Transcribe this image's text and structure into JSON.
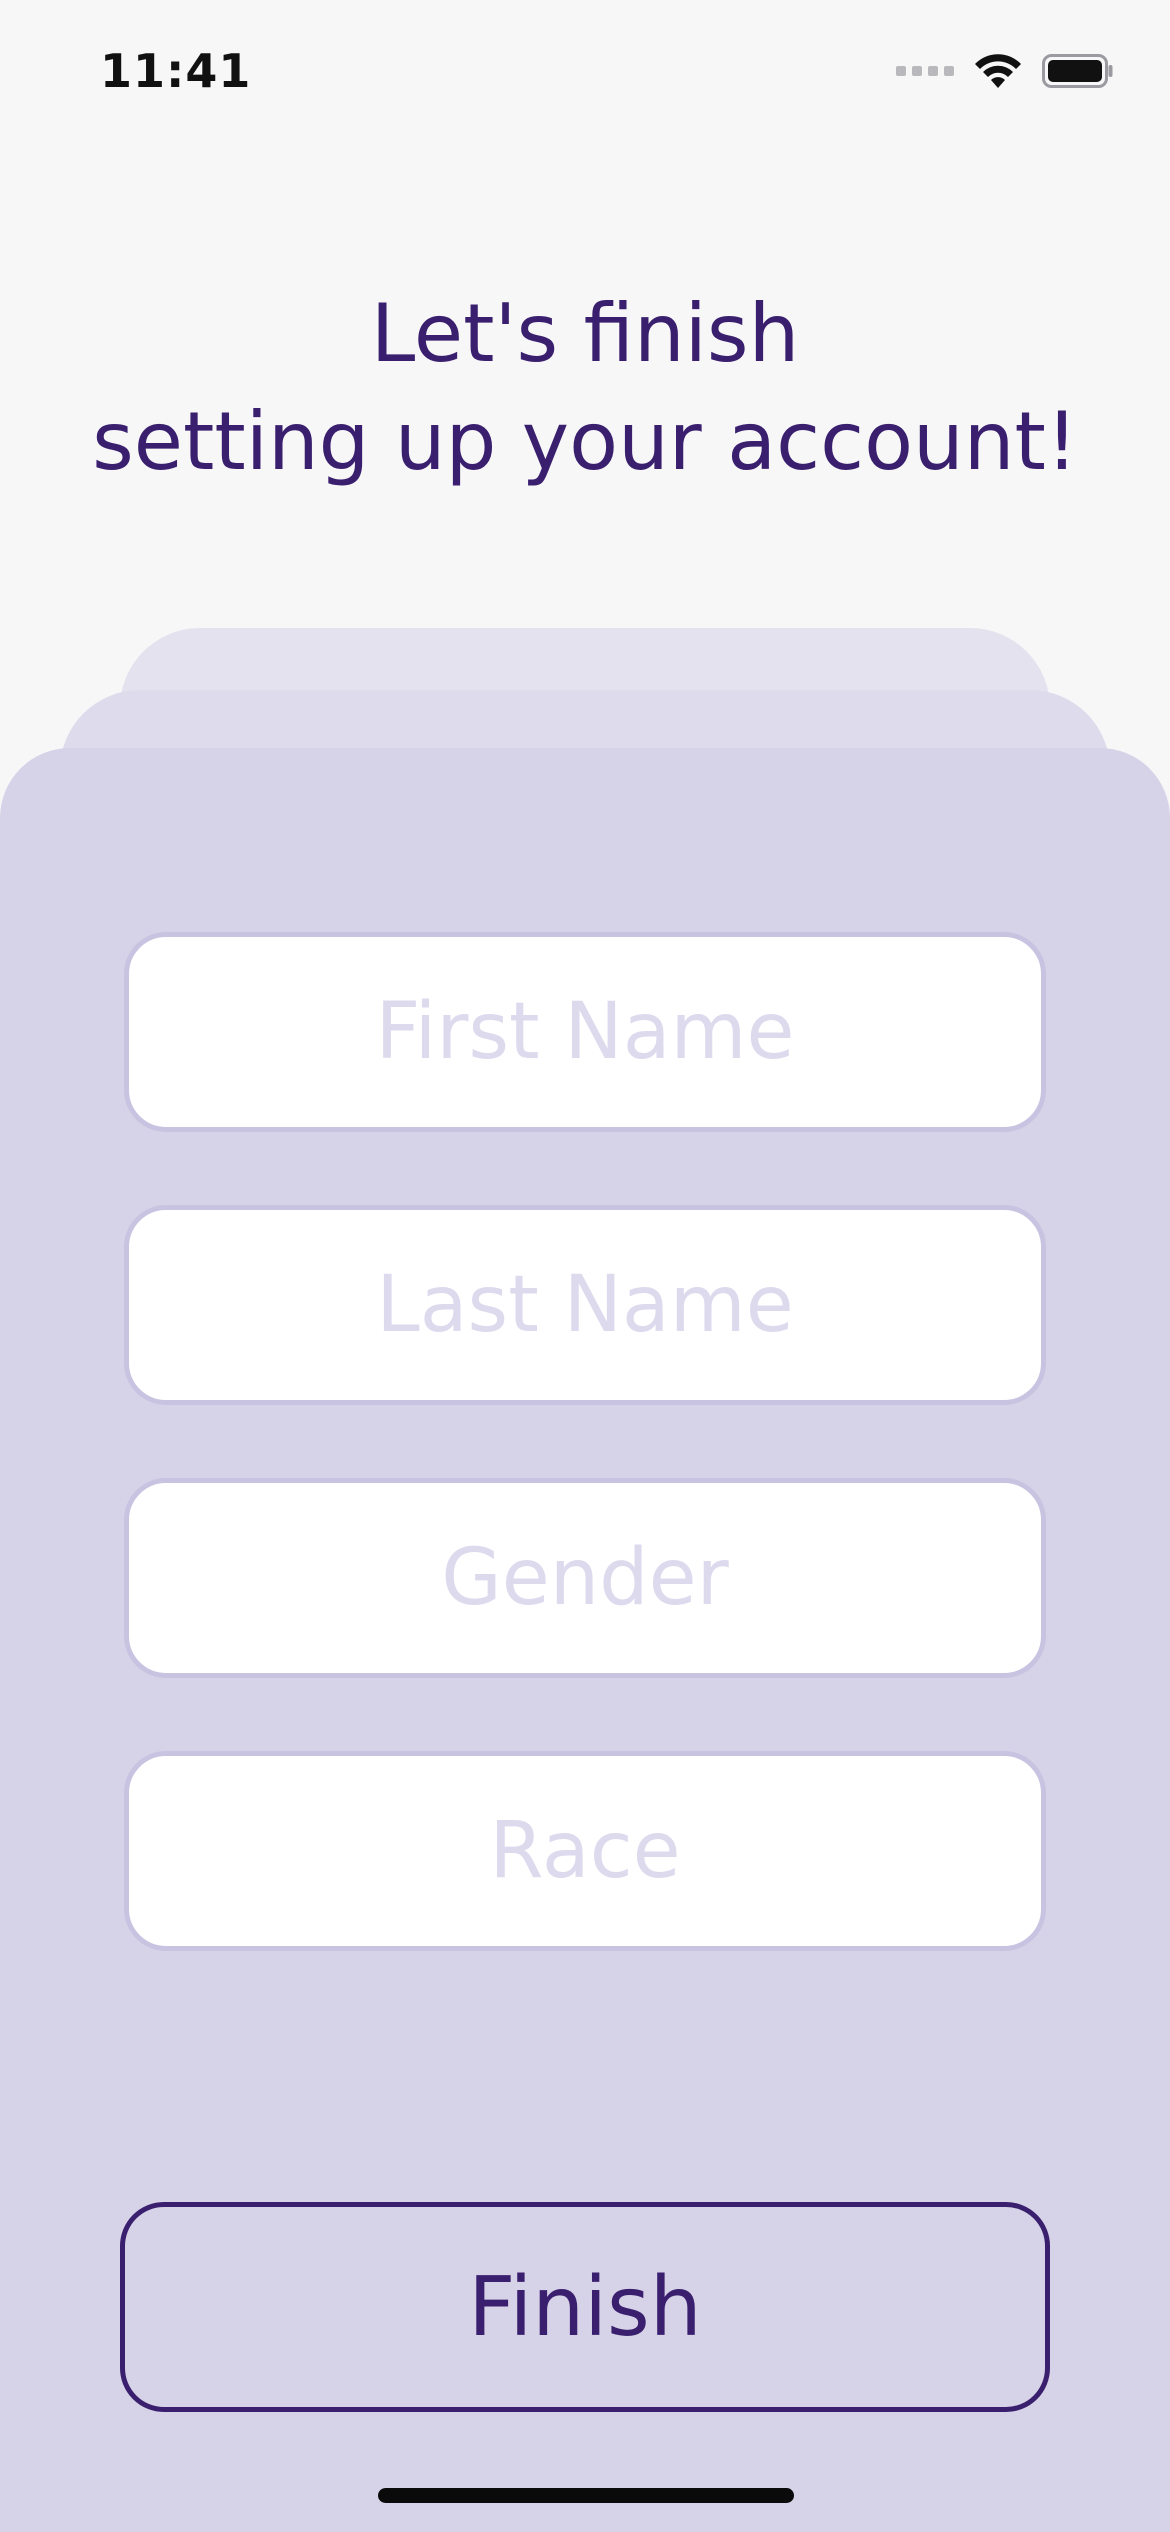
{
  "status_bar": {
    "time": "11:41"
  },
  "heading": {
    "line1": "Let's finish",
    "line2": "setting up your account!"
  },
  "form": {
    "first_name": {
      "placeholder": "First Name",
      "value": ""
    },
    "last_name": {
      "placeholder": "Last Name",
      "value": ""
    },
    "gender": {
      "placeholder": "Gender",
      "value": ""
    },
    "race": {
      "placeholder": "Race",
      "value": ""
    }
  },
  "finish_button": {
    "label": "Finish"
  },
  "icons": {
    "signal": "signal-dots-icon",
    "wifi": "wifi-icon",
    "battery": "battery-icon"
  },
  "colors": {
    "accent": "#3a1f6e",
    "card_background": "#d6d2e8",
    "placeholder": "#dddaee"
  }
}
